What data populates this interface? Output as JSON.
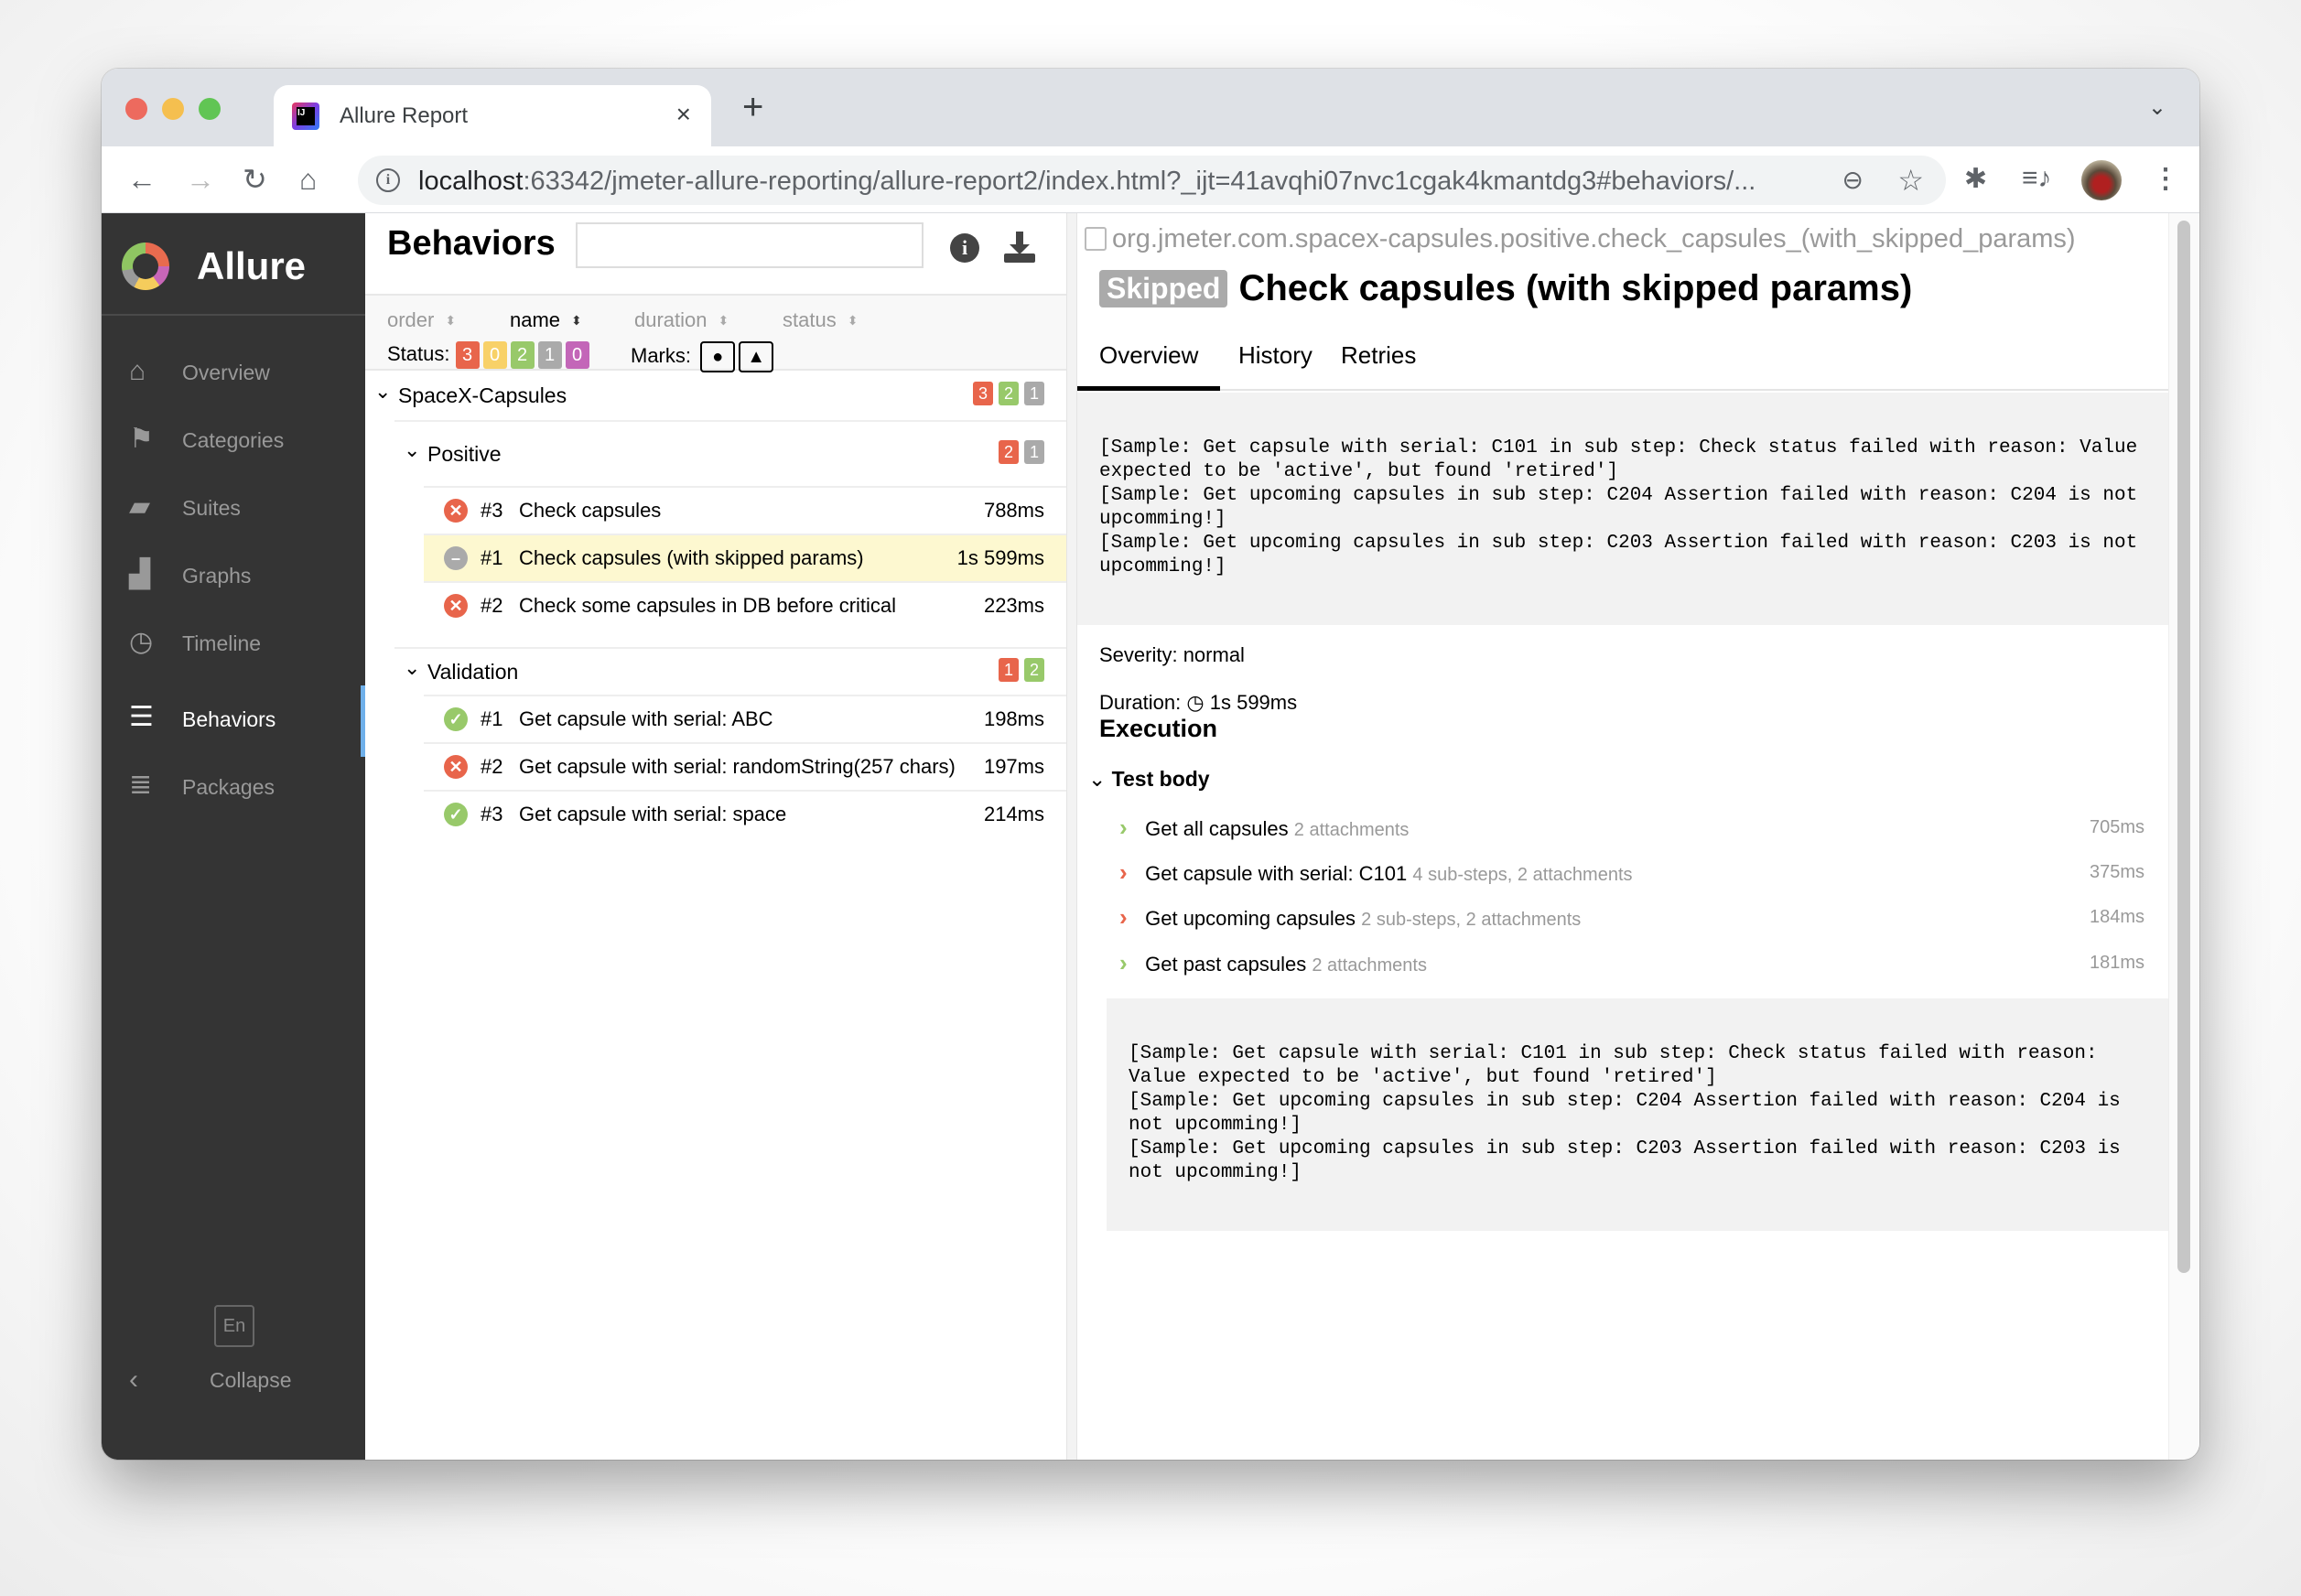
{
  "browser": {
    "tab_title": "Allure Report",
    "url_host": "localhost",
    "url_rest": ":63342/jmeter-allure-reporting/allure-report2/index.html?_ijt=41avqhi07nvc1cgak4kmantdg3#behaviors/..."
  },
  "sidebar": {
    "brand": "Allure",
    "items": [
      {
        "label": "Overview",
        "icon": "home-icon"
      },
      {
        "label": "Categories",
        "icon": "flag-icon"
      },
      {
        "label": "Suites",
        "icon": "briefcase-icon"
      },
      {
        "label": "Graphs",
        "icon": "bar-chart-icon"
      },
      {
        "label": "Timeline",
        "icon": "clock-icon"
      },
      {
        "label": "Behaviors",
        "icon": "list-icon",
        "active": true
      },
      {
        "label": "Packages",
        "icon": "packages-icon"
      }
    ],
    "language": "En",
    "collapse_label": "Collapse"
  },
  "behaviors": {
    "title": "Behaviors",
    "search_value": "",
    "sort": {
      "order": "order",
      "name": "name",
      "duration": "duration",
      "status": "status"
    },
    "status_label": "Status:",
    "status_counts": {
      "failed": "3",
      "broken": "0",
      "passed": "2",
      "skipped": "1",
      "unknown": "0"
    },
    "marks_label": "Marks:",
    "tree": {
      "name": "SpaceX-Capsules",
      "counts": [
        "3",
        "2",
        "1"
      ],
      "groups": [
        {
          "name": "Positive",
          "counts": [
            "2",
            "1"
          ],
          "tests": [
            {
              "num": "#3",
              "name": "Check capsules",
              "duration": "788ms",
              "status": "failed"
            },
            {
              "num": "#1",
              "name": "Check capsules (with skipped params)",
              "duration": "1s 599ms",
              "status": "skipped"
            },
            {
              "num": "#2",
              "name": "Check some capsules in DB before critical",
              "duration": "223ms",
              "status": "failed"
            }
          ]
        },
        {
          "name": "Validation",
          "counts": [
            "1",
            "2"
          ],
          "tests": [
            {
              "num": "#1",
              "name": "Get capsule with serial: ABC",
              "duration": "198ms",
              "status": "passed"
            },
            {
              "num": "#2",
              "name": "Get capsule with serial: randomString(257 chars)",
              "duration": "197ms",
              "status": "failed"
            },
            {
              "num": "#3",
              "name": "Get capsule with serial: space",
              "duration": "214ms",
              "status": "passed"
            }
          ]
        }
      ]
    }
  },
  "detail": {
    "full_name": "org.jmeter.com.spacex-capsules.positive.check_capsules_(with_skipped_params)",
    "status_badge": "Skipped",
    "title": "Check capsules (with skipped params)",
    "tabs": [
      "Overview",
      "History",
      "Retries"
    ],
    "message": "[Sample: Get capsule with serial: C101 in sub step: Check status failed with reason: Value expected to be 'active', but found 'retired']\n[Sample: Get upcoming capsules in sub step: C204 Assertion failed with reason: C204 is not upcomming!]\n[Sample: Get upcoming capsules in sub step: C203 Assertion failed with reason: C203 is not upcomming!]",
    "severity": "Severity: normal",
    "duration_label": "Duration:",
    "duration": "1s 599ms",
    "execution_title": "Execution",
    "test_body_label": "Test body",
    "steps": [
      {
        "name": "Get all capsules",
        "extra": "2 attachments",
        "duration": "705ms",
        "status": "passed"
      },
      {
        "name": "Get capsule with serial: C101",
        "extra": "4 sub-steps, 2 attachments",
        "duration": "375ms",
        "status": "failed"
      },
      {
        "name": "Get upcoming capsules",
        "extra": "2 sub-steps, 2 attachments",
        "duration": "184ms",
        "status": "failed"
      },
      {
        "name": "Get past capsules",
        "extra": "2 attachments",
        "duration": "181ms",
        "status": "passed"
      }
    ],
    "body_message": "[Sample: Get capsule with serial: C101 in sub step: Check status failed with reason: Value expected to be 'active', but found 'retired']\n[Sample: Get upcoming capsules in sub step: C204 Assertion failed with reason: C204 is not upcomming!]\n[Sample: Get upcoming capsules in sub step: C203 Assertion failed with reason: C203 is not upcomming!]"
  }
}
